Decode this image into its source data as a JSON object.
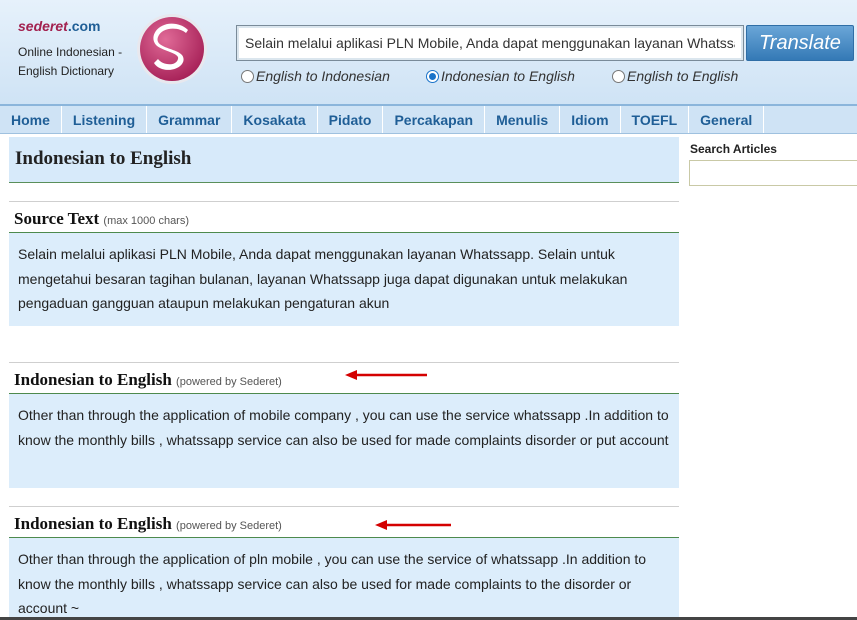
{
  "header": {
    "brand_part1": "sederet",
    "brand_part2": ".com",
    "tagline_line1": "Online Indonesian -",
    "tagline_line2": "English Dictionary",
    "logo_icon": "sederet-s-logo",
    "search_value": "Selain melalui aplikasi PLN Mobile, Anda dapat menggunakan layanan Whatssapp",
    "translate_label": "Translate",
    "radios": [
      {
        "label": "English to Indonesian",
        "checked": false
      },
      {
        "label": "Indonesian to English",
        "checked": true
      },
      {
        "label": "English to English",
        "checked": false
      }
    ]
  },
  "nav": {
    "items": [
      "Home",
      "Listening",
      "Grammar",
      "Kosakata",
      "Pidato",
      "Percakapan",
      "Menulis",
      "Idiom",
      "TOEFL",
      "General"
    ]
  },
  "main": {
    "page_title": "Indonesian to English",
    "source": {
      "title": "Source Text",
      "subtitle": "(max 1000 chars)",
      "text": "Selain melalui aplikasi PLN Mobile, Anda dapat menggunakan layanan Whatssapp. Selain untuk mengetahui besaran tagihan bulanan, layanan Whatssapp juga dapat digunakan untuk melakukan pengaduan gangguan ataupun melakukan pengaturan akun"
    },
    "results": [
      {
        "title": "Indonesian to English",
        "subtitle": "(powered by Sederet)",
        "text": "Other than through the application of mobile company , you can use the service whatssapp .In addition to know the monthly bills , whatssapp service can also be used for made complaints disorder or put account"
      },
      {
        "title": "Indonesian to English",
        "subtitle": "(powered by Sederet)",
        "text": "Other than through the application of pln mobile , you can use the service of whatssapp .In addition to know the monthly bills , whatssapp service can also be used for made complaints to the disorder or account ~"
      }
    ]
  },
  "sidebar": {
    "search_label": "Search Articles",
    "search_value": ""
  },
  "colors": {
    "brand_magenta": "#a2214f",
    "brand_blue": "#1f5e96",
    "panel_blue": "#dcedfb",
    "arrow_red": "#d40000"
  }
}
